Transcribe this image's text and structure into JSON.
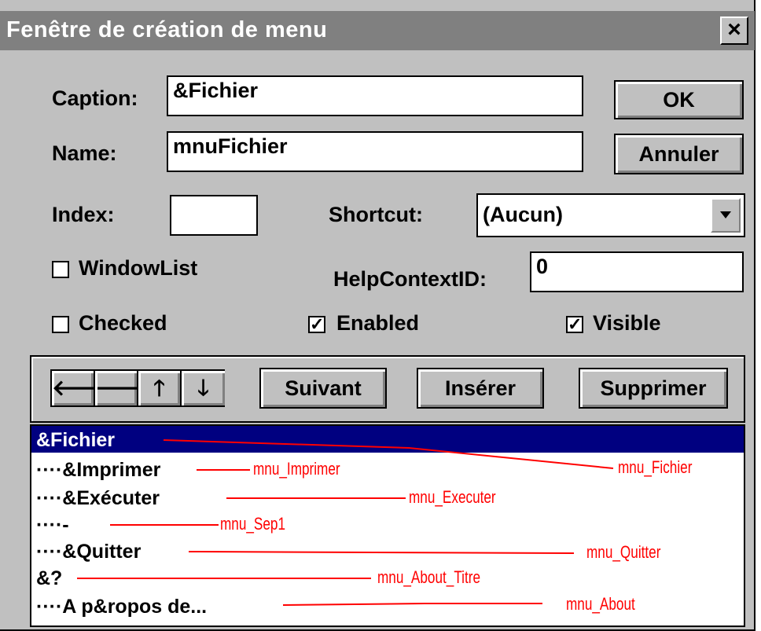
{
  "window": {
    "title": "Fenêtre de création de menu",
    "close_glyph": "×"
  },
  "form": {
    "caption_label": "Caption:",
    "caption_value": "&Fichier",
    "name_label": "Name:",
    "name_value": "mnuFichier",
    "index_label": "Index:",
    "index_value": "",
    "shortcut_label": "Shortcut:",
    "shortcut_value": "(Aucun)",
    "windowlist_label": "WindowList",
    "windowlist_checked": false,
    "helpcontext_label": "HelpContextID:",
    "helpcontext_value": "0",
    "checked_label": "Checked",
    "checked_checked": false,
    "enabled_label": "Enabled",
    "enabled_checked": true,
    "visible_label": "Visible",
    "visible_checked": true
  },
  "buttons": {
    "ok": "OK",
    "cancel": "Annuler",
    "next": "Suivant",
    "insert": "Insérer",
    "delete": "Supprimer"
  },
  "arrows": {
    "left": "🡐",
    "right": "🡒",
    "up": "🡑",
    "down": "🡓"
  },
  "menu_items": [
    {
      "label": "&Fichier",
      "annotation": "mnu_Fichier"
    },
    {
      "label": "····&Imprimer",
      "annotation": "mnu_Imprimer"
    },
    {
      "label": "····&Exécuter",
      "annotation": "mnu_Executer"
    },
    {
      "label": "····-",
      "annotation": "mnu_Sep1"
    },
    {
      "label": "····&Quitter",
      "annotation": "mnu_Quitter"
    },
    {
      "label": "&?",
      "annotation": "mnu_About_Titre"
    },
    {
      "label": "····A p&ropos de...",
      "annotation": "mnu_About"
    }
  ],
  "colors": {
    "selection": "#000080",
    "annotation": "#ff0000",
    "face": "#c0c0c0",
    "titlebar": "#808080"
  }
}
